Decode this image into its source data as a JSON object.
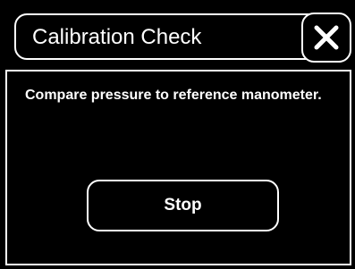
{
  "dialog": {
    "title": "Calibration Check",
    "message": "Compare pressure to reference manometer.",
    "stop_label": "Stop",
    "close_icon": "close-icon"
  },
  "colors": {
    "background": "#000000",
    "foreground": "#ffffff"
  }
}
